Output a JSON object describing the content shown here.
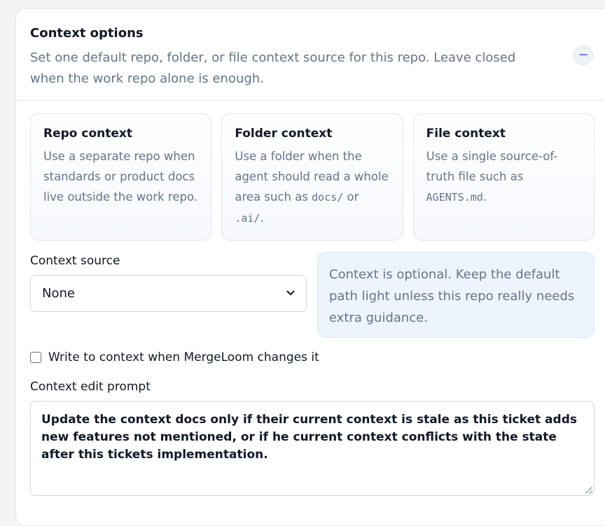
{
  "header": {
    "title": "Context options",
    "description": "Set one default repo, folder, or file context source for this repo. Leave closed when the work repo alone is enough.",
    "collapse_symbol": "−"
  },
  "cards": [
    {
      "title": "Repo context",
      "desc": "Use a separate repo when standards or product docs live outside the work repo."
    },
    {
      "title": "Folder context",
      "desc_before": "Use a folder when the agent should read a whole area such as ",
      "code1": "docs/",
      "desc_mid": " or ",
      "code2": ".ai/",
      "desc_after": "."
    },
    {
      "title": "File context",
      "desc_before": "Use a single source-of-truth file such as ",
      "code": "AGENTS.md",
      "desc_after": "."
    }
  ],
  "source": {
    "label": "Context source",
    "selected": "None"
  },
  "info": {
    "text": "Context is optional. Keep the default path light unless this repo really needs extra guidance."
  },
  "write_checkbox": {
    "label": "Write to context when MergeLoom changes it",
    "checked": false
  },
  "prompt": {
    "label": "Context edit prompt",
    "value": "Update the context docs only if their current context is stale as this ticket adds new features not mentioned, or if he current context conflicts with the state after this tickets implementation."
  },
  "icons": {
    "collapse": "minus-icon",
    "select": "chevron-down-icon",
    "resize": "resize-grip-icon"
  }
}
